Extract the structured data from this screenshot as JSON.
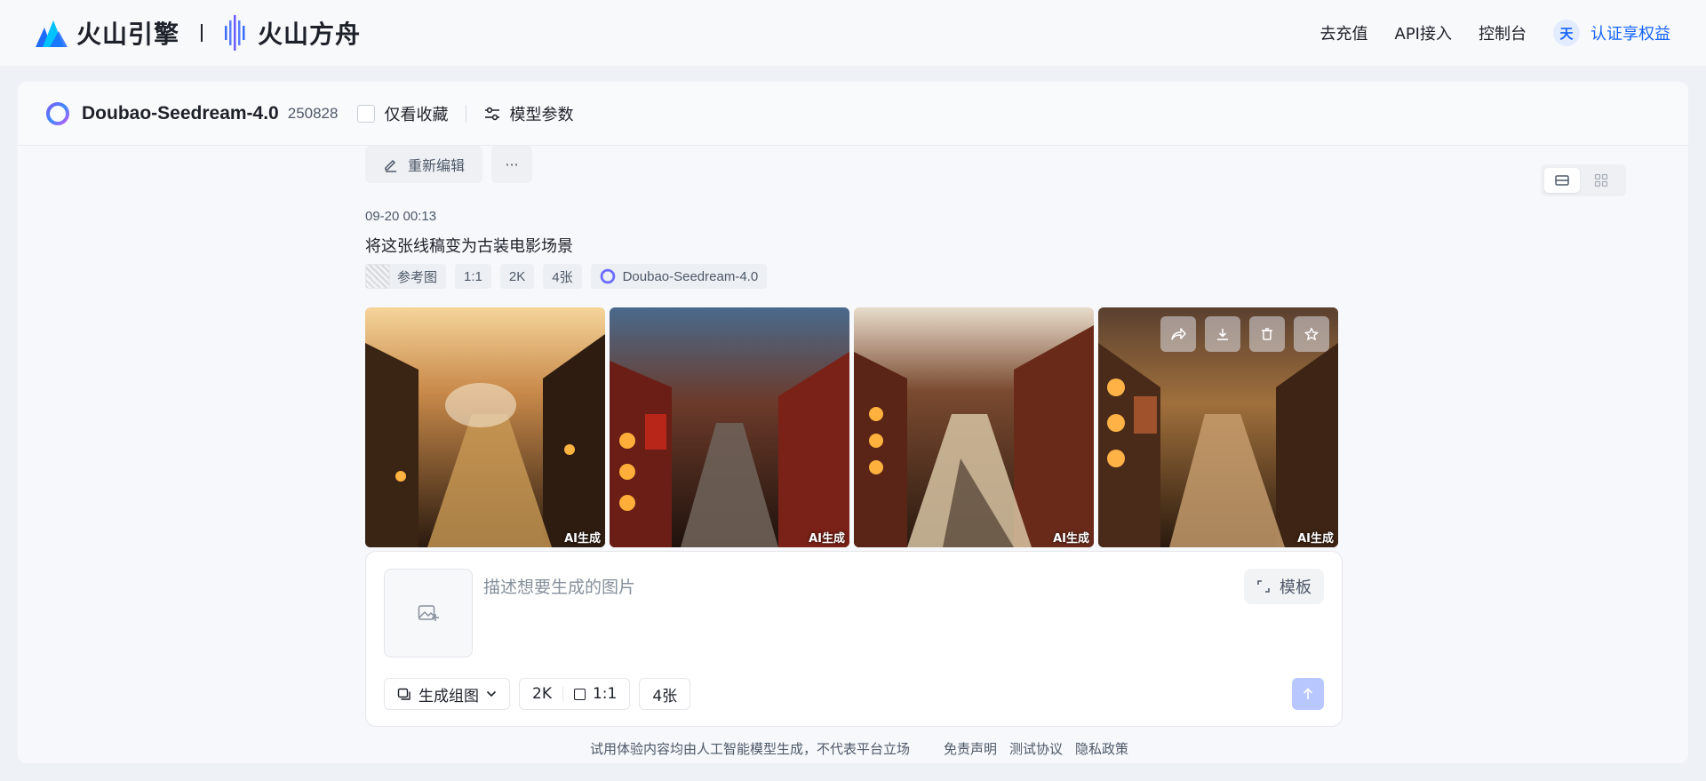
{
  "nav": {
    "brand_primary": "火山引擎",
    "brand_secondary": "火山方舟",
    "links": [
      "去充值",
      "API接入",
      "控制台"
    ],
    "avatar_text": "天",
    "user_link": "认证享权益"
  },
  "header": {
    "model_name": "Doubao-Seedream-4.0",
    "model_version": "250828",
    "favorites_label": "仅看收藏",
    "params_label": "模型参数"
  },
  "prev_message": {
    "reedit_label": "重新编辑",
    "more_label": "···"
  },
  "message": {
    "time": "09-20 00:13",
    "prompt": "将这张线稿变为古装电影场景",
    "tags": {
      "reference": "参考图",
      "ratio": "1:1",
      "resolution": "2K",
      "count": "4张",
      "model": "Doubao-Seedream-4.0"
    },
    "images": [
      {
        "label": "AI生成"
      },
      {
        "label": "AI生成"
      },
      {
        "label": "AI生成"
      },
      {
        "label": "AI生成"
      }
    ]
  },
  "composer": {
    "placeholder": "描述想要生成的图片",
    "template_label": "模板",
    "mode_label": "生成组图",
    "resolution": "2K",
    "ratio": "1:1",
    "count": "4张"
  },
  "footer": {
    "notice": "试用体验内容均由人工智能模型生成，不代表平台立场",
    "links": [
      "免责声明",
      "测试协议",
      "隐私政策"
    ]
  },
  "colors": {
    "accent": "#1664ff",
    "send_disabled": "#b9c7ff"
  }
}
